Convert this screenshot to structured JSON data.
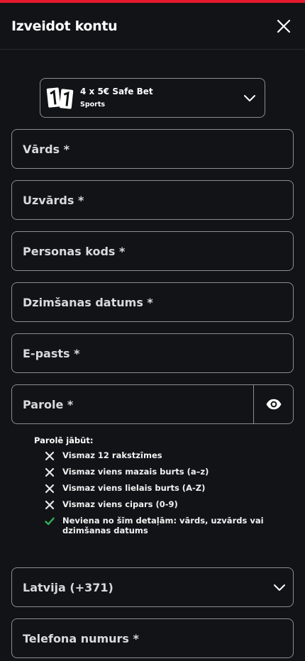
{
  "header": {
    "title": "Izveidot kontu"
  },
  "bonus": {
    "title": "4 x 5€ Safe Bet",
    "subtitle": "Sports",
    "logo_text": "11"
  },
  "fields": {
    "first_name": "Vārds *",
    "last_name": "Uzvārds *",
    "personal_code": "Personas kods *",
    "birth_date": "Dzimšanas datums *",
    "email": "E-pasts *",
    "password": "Parole *",
    "country": "Latvija (+371)",
    "phone": "Telefona numurs *"
  },
  "password_rules": {
    "title": "Parolē jābūt:",
    "items": [
      {
        "text": "Vismaz 12 rakstzīmes",
        "status": "fail"
      },
      {
        "text": "Vismaz viens mazais burts (a–z)",
        "status": "fail"
      },
      {
        "text": "Vismaz viens lielais burts (A-Z)",
        "status": "fail"
      },
      {
        "text": "Vismaz viens cipars (0-9)",
        "status": "fail"
      },
      {
        "text": "Neviena no šīm detaļām: vārds, uzvārds vai dzimšanas datums",
        "status": "pass"
      }
    ]
  },
  "colors": {
    "accent": "#e4192c",
    "pass": "#2fb457",
    "background": "#121317",
    "border": "#8c8d92"
  }
}
